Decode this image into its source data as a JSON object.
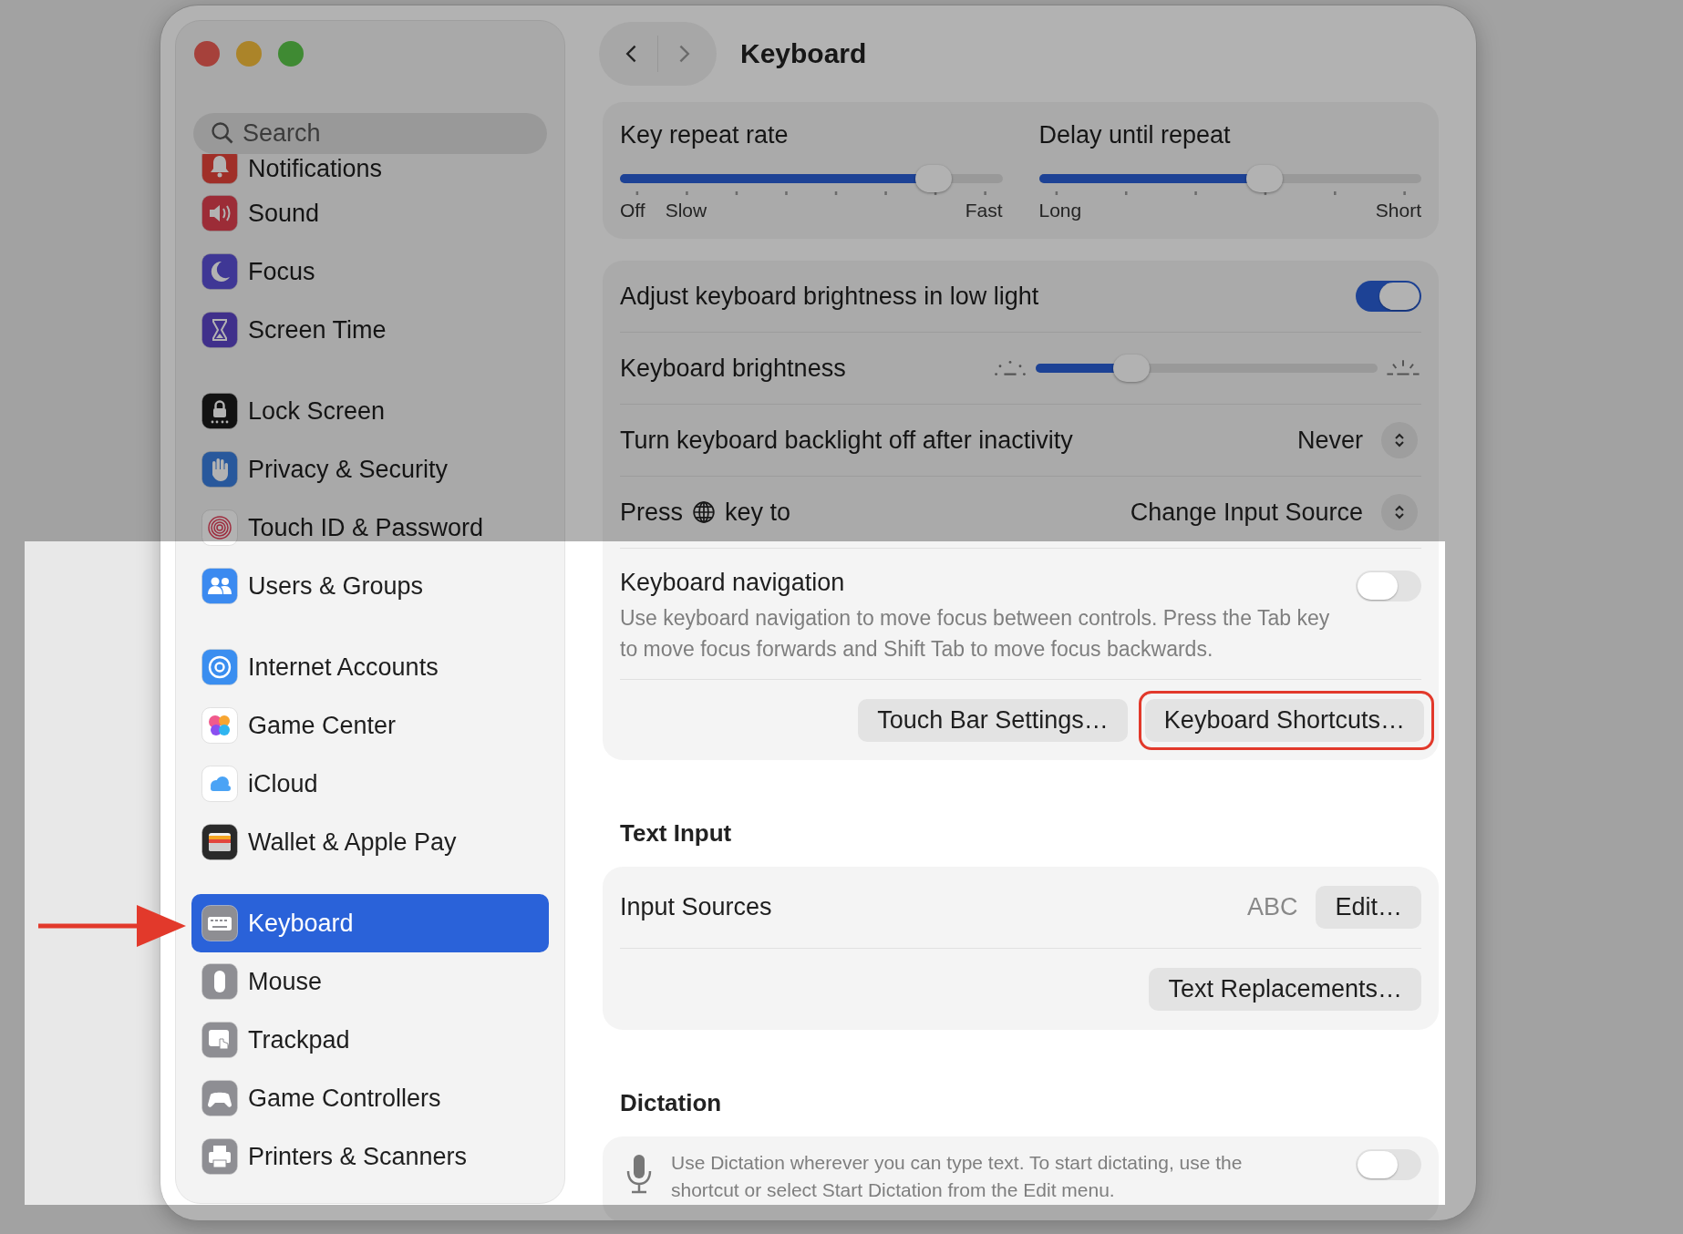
{
  "search": {
    "placeholder": "Search"
  },
  "sidebar": {
    "groups": [
      {
        "items": [
          {
            "label": "Notifications",
            "selected": false
          },
          {
            "label": "Sound",
            "selected": false
          },
          {
            "label": "Focus",
            "selected": false
          },
          {
            "label": "Screen Time",
            "selected": false
          }
        ]
      },
      {
        "items": [
          {
            "label": "Lock Screen",
            "selected": false
          },
          {
            "label": "Privacy & Security",
            "selected": false
          },
          {
            "label": "Touch ID & Password",
            "selected": false
          },
          {
            "label": "Users & Groups",
            "selected": false
          }
        ]
      },
      {
        "items": [
          {
            "label": "Internet Accounts",
            "selected": false
          },
          {
            "label": "Game Center",
            "selected": false
          },
          {
            "label": "iCloud",
            "selected": false
          },
          {
            "label": "Wallet & Apple Pay",
            "selected": false
          }
        ]
      },
      {
        "items": [
          {
            "label": "Keyboard",
            "selected": true
          },
          {
            "label": "Mouse",
            "selected": false
          },
          {
            "label": "Trackpad",
            "selected": false
          },
          {
            "label": "Game Controllers",
            "selected": false
          },
          {
            "label": "Printers & Scanners",
            "selected": false
          }
        ]
      }
    ]
  },
  "toolbar": {
    "title": "Keyboard"
  },
  "repeat_sliders": [
    {
      "label": "Key repeat rate",
      "level": 0.82,
      "tick_labels": [
        "Off",
        "Slow",
        "Fast"
      ]
    },
    {
      "label": "Delay until repeat",
      "level": 0.59,
      "tick_labels": [
        "Long",
        "Short"
      ]
    }
  ],
  "keyboard_settings": {
    "rows": [
      {
        "kind": "toggle",
        "label": "Adjust keyboard brightness in low light",
        "on": true
      },
      {
        "kind": "slider",
        "label": "Keyboard brightness",
        "level": 0.28
      },
      {
        "kind": "popup",
        "label": "Turn keyboard backlight off after inactivity",
        "value": "Never"
      },
      {
        "kind": "popup",
        "label": "Press",
        "label_after": "key to",
        "value": "Change Input Source"
      },
      {
        "kind": "toggle_description",
        "label": "Keyboard navigation",
        "description": "Use keyboard navigation to move focus between controls. Press the Tab key to move focus forwards and Shift Tab to move focus backwards.",
        "on": false
      }
    ],
    "buttons": [
      {
        "label": "Touch Bar Settings…",
        "highlighted": false
      },
      {
        "label": "Keyboard Shortcuts…",
        "highlighted": true
      }
    ]
  },
  "text_input": {
    "title": "Text Input",
    "rows": [
      {
        "kind": "value_button",
        "label": "Input Sources",
        "value": "ABC",
        "button": "Edit…"
      },
      {
        "kind": "button",
        "button": "Text Replacements…"
      }
    ]
  },
  "dictation": {
    "title": "Dictation",
    "description": "Use Dictation wherever you can type text. To start dictating, use the shortcut or select Start Dictation from the Edit menu.",
    "on": false
  }
}
